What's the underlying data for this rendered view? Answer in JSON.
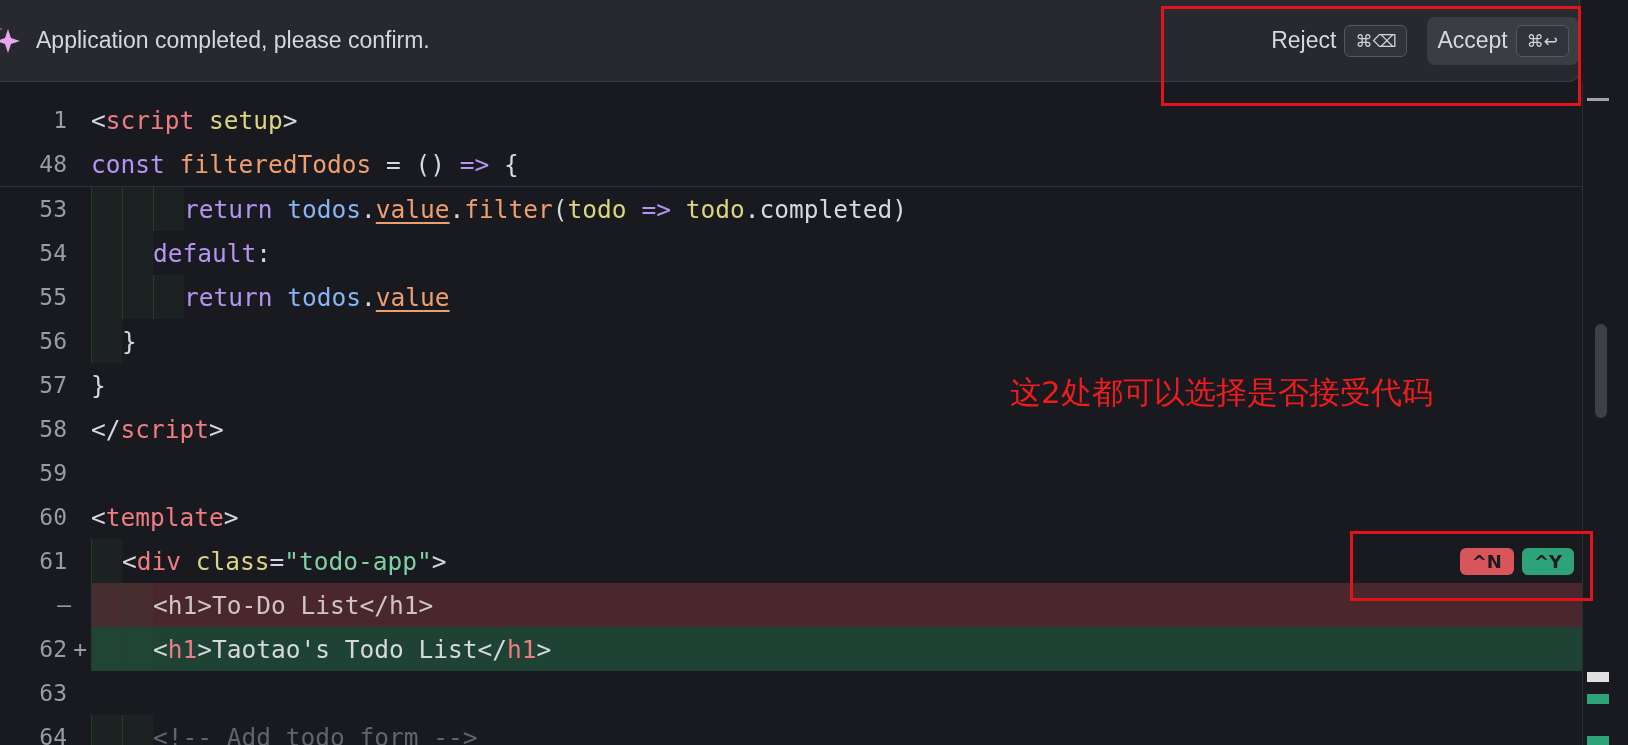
{
  "banner": {
    "message": "Application completed, please confirm.",
    "buttons": [
      {
        "label": "Reject",
        "shortcut": "⌘⌫",
        "selected": false
      },
      {
        "label": "Accept",
        "shortcut": "⌘↩",
        "selected": true
      }
    ]
  },
  "editor": {
    "sticky_lines": [
      {
        "number": "1",
        "tokens": [
          {
            "kind": "punct",
            "text": "<"
          },
          {
            "kind": "tag",
            "text": "script"
          },
          {
            "kind": "attr",
            "text": " setup"
          },
          {
            "kind": "punct",
            "text": ">"
          }
        ]
      },
      {
        "number": "48",
        "tokens": [
          {
            "kind": "keyword",
            "text": "const"
          },
          {
            "kind": "func",
            "text": " filteredTodos"
          },
          {
            "kind": "punct",
            "text": " = () "
          },
          {
            "kind": "keyword",
            "text": "=>"
          },
          {
            "kind": "punct",
            "text": " {"
          }
        ]
      }
    ],
    "lines": [
      {
        "number": "53",
        "kind": "normal",
        "tokens": [
          {
            "kind": "keyword",
            "text": "      return"
          },
          {
            "kind": "var",
            "text": " todos"
          },
          {
            "kind": "punct",
            "text": "."
          },
          {
            "kind": "ref",
            "text": "value"
          },
          {
            "kind": "punct",
            "text": "."
          },
          {
            "kind": "func",
            "text": "filter"
          },
          {
            "kind": "punct",
            "text": "("
          },
          {
            "kind": "attr",
            "text": "todo"
          },
          {
            "kind": "keyword",
            "text": " =>"
          },
          {
            "kind": "attr",
            "text": " todo"
          },
          {
            "kind": "punct",
            "text": ".completed)"
          }
        ]
      },
      {
        "number": "54",
        "kind": "normal",
        "tokens": [
          {
            "kind": "keyword",
            "text": "    default"
          },
          {
            "kind": "punct",
            "text": ":"
          }
        ]
      },
      {
        "number": "55",
        "kind": "normal",
        "tokens": [
          {
            "kind": "keyword",
            "text": "      return"
          },
          {
            "kind": "var",
            "text": " todos"
          },
          {
            "kind": "punct",
            "text": "."
          },
          {
            "kind": "ref",
            "text": "value"
          }
        ]
      },
      {
        "number": "56",
        "kind": "normal",
        "tokens": [
          {
            "kind": "punct",
            "text": "  }"
          }
        ]
      },
      {
        "number": "57",
        "kind": "normal",
        "tokens": [
          {
            "kind": "punct",
            "text": "}"
          }
        ]
      },
      {
        "number": "58",
        "kind": "normal",
        "tokens": [
          {
            "kind": "punct",
            "text": "</"
          },
          {
            "kind": "tag",
            "text": "script"
          },
          {
            "kind": "punct",
            "text": ">"
          }
        ]
      },
      {
        "number": "59",
        "kind": "normal"
      },
      {
        "number": "60",
        "kind": "normal",
        "tokens": [
          {
            "kind": "punct",
            "text": "<"
          },
          {
            "kind": "tag",
            "text": "template"
          },
          {
            "kind": "punct",
            "text": ">"
          }
        ]
      },
      {
        "number": "61",
        "kind": "normal",
        "hunk_actions": [
          {
            "label": "^N",
            "kind": "reject"
          },
          {
            "label": "^Y",
            "kind": "accept"
          }
        ],
        "tokens": [
          {
            "kind": "punct",
            "text": "  <"
          },
          {
            "kind": "tag",
            "text": "div"
          },
          {
            "kind": "attr",
            "text": " class"
          },
          {
            "kind": "punct",
            "text": "="
          },
          {
            "kind": "string",
            "text": "\"todo-app\""
          },
          {
            "kind": "punct",
            "text": ">"
          }
        ]
      },
      {
        "marker": "—",
        "kind": "removed",
        "tokens": [
          {
            "kind": "punct",
            "text": "    <h1>To-Do List</h1>"
          }
        ]
      },
      {
        "number": "62",
        "marker": "+",
        "kind": "added",
        "tokens": [
          {
            "kind": "punct",
            "text": "    <"
          },
          {
            "kind": "tag",
            "text": "h1"
          },
          {
            "kind": "punct",
            "text": ">Taotao's Todo List</"
          },
          {
            "kind": "tag",
            "text": "h1"
          },
          {
            "kind": "punct",
            "text": ">"
          }
        ]
      },
      {
        "number": "63",
        "kind": "normal"
      },
      {
        "number": "64",
        "kind": "normal",
        "tokens": [
          {
            "kind": "comment",
            "text": "    <!-- Add todo form -->"
          }
        ]
      }
    ]
  },
  "annotation": {
    "note": "这2处都可以选择是否接受代码"
  }
}
